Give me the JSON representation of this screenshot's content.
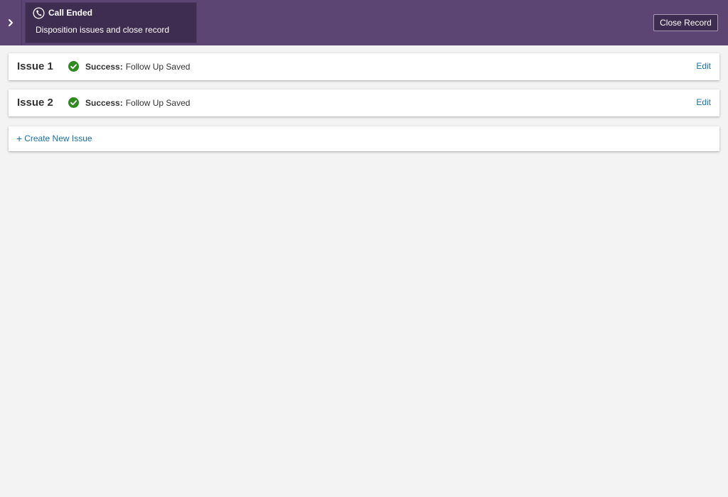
{
  "header": {
    "call_title": "Call Ended",
    "call_subtitle": "Disposition issues and close record",
    "close_button_label": "Close Record",
    "icons": {
      "toggle": "chevron-right-icon",
      "call": "phone-icon"
    }
  },
  "issues": [
    {
      "title": "Issue 1",
      "status_label": "Success:",
      "status_text": "Follow Up Saved",
      "edit_label": "Edit"
    },
    {
      "title": "Issue 2",
      "status_label": "Success:",
      "status_text": "Follow Up Saved",
      "edit_label": "Edit"
    }
  ],
  "create": {
    "plus": "+",
    "label": "Create New Issue"
  },
  "colors": {
    "header_bg": "#5c4573",
    "panel_bg": "#3f2d51",
    "success_green": "#2e8b1e",
    "link_blue": "#1a6fa3",
    "page_bg": "#f3f3f3"
  }
}
